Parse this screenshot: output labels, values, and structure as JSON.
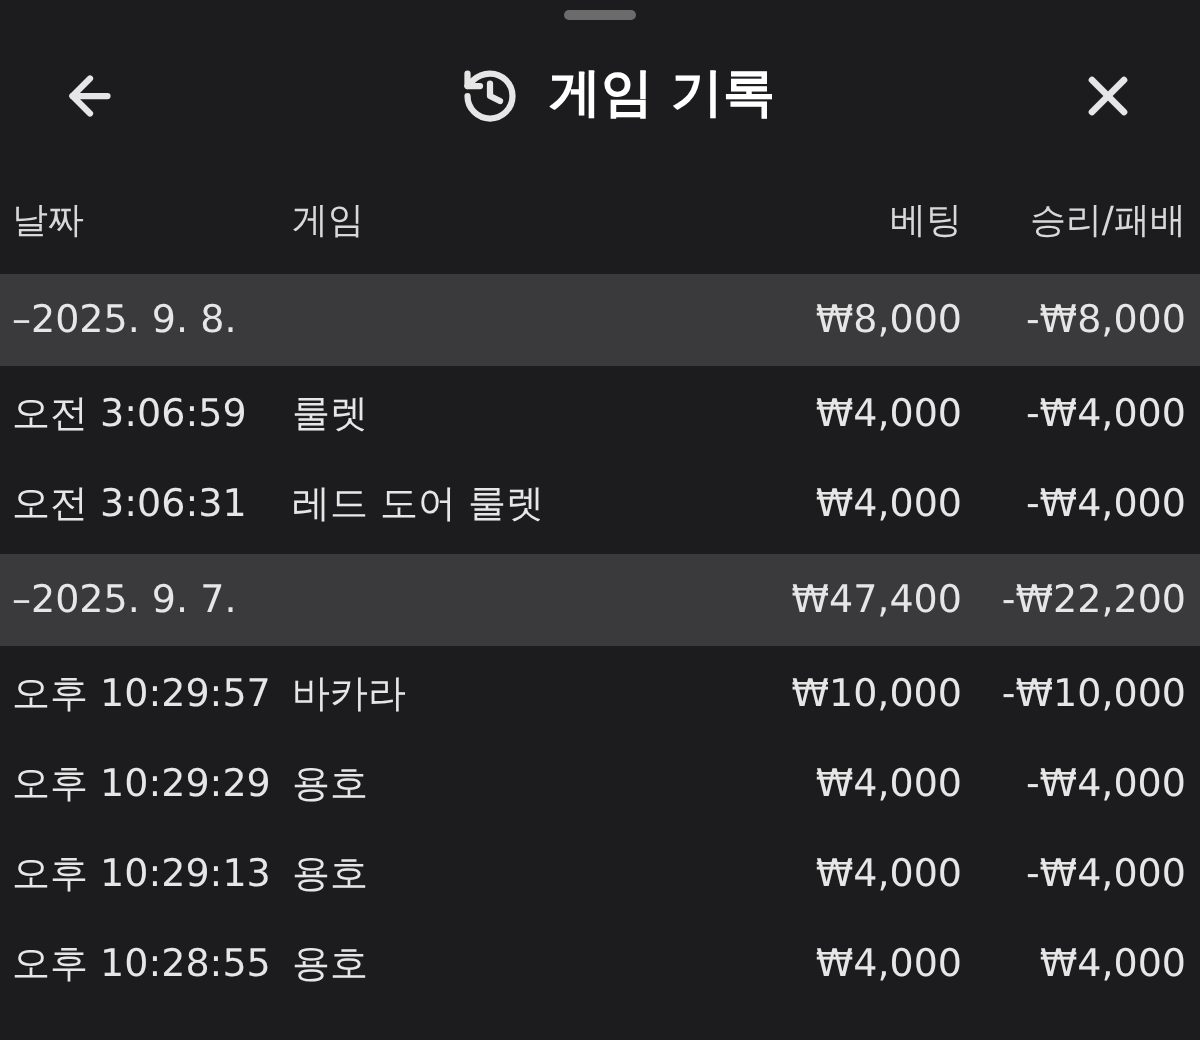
{
  "header": {
    "title": "게임 기록"
  },
  "columns": [
    "날짜",
    "게임",
    "베팅",
    "승리/패배"
  ],
  "groups": [
    {
      "date": "–2025. 9. 8.",
      "bet": "₩8,000",
      "result": "-₩8,000",
      "rows": [
        {
          "time": "오전 3:06:59",
          "game": "룰렛",
          "bet": "₩4,000",
          "result": "-₩4,000"
        },
        {
          "time": "오전 3:06:31",
          "game": "레드 도어 룰렛",
          "bet": "₩4,000",
          "result": "-₩4,000"
        }
      ]
    },
    {
      "date": "–2025. 9. 7.",
      "bet": "₩47,400",
      "result": "-₩22,200",
      "rows": [
        {
          "time": "오후 10:29:57",
          "game": "바카라",
          "bet": "₩10,000",
          "result": "-₩10,000"
        },
        {
          "time": "오후 10:29:29",
          "game": "용호",
          "bet": "₩4,000",
          "result": "-₩4,000"
        },
        {
          "time": "오후 10:29:13",
          "game": "용호",
          "bet": "₩4,000",
          "result": "-₩4,000"
        },
        {
          "time": "오후 10:28:55",
          "game": "용호",
          "bet": "₩4,000",
          "result": "₩4,000"
        }
      ]
    }
  ]
}
